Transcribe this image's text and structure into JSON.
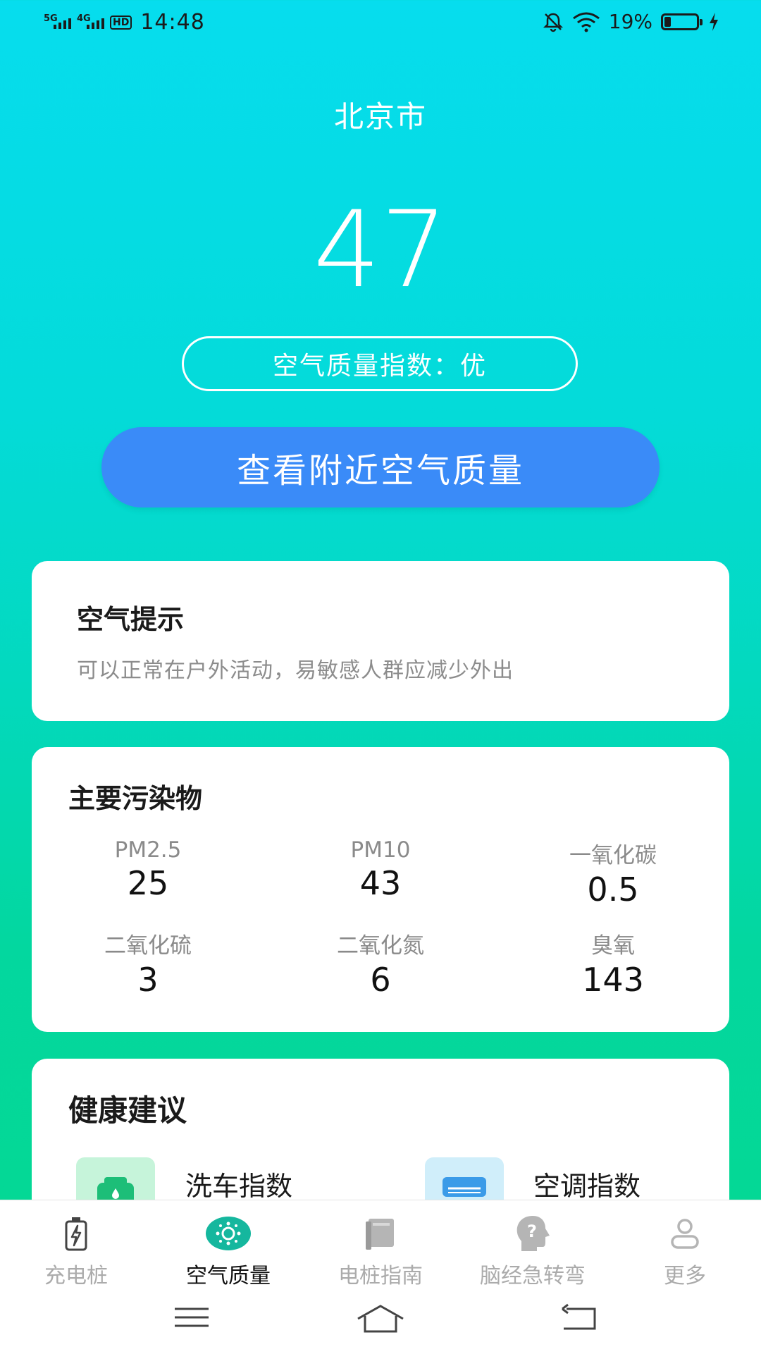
{
  "status_bar": {
    "signal1": "5G",
    "signal2": "4G",
    "hd": "HD",
    "time": "14:48",
    "battery": "19%"
  },
  "header": {
    "city": "北京市",
    "aqi_value": "47",
    "aqi_label": "空气质量指数：优",
    "nearby_button": "查看附近空气质量"
  },
  "tips": {
    "title": "空气提示",
    "text": "可以正常在户外活动，易敏感人群应减少外出"
  },
  "pollutants": {
    "title": "主要污染物",
    "items": [
      {
        "name": "PM2.5",
        "value": "25"
      },
      {
        "name": "PM10",
        "value": "43"
      },
      {
        "name": "一氧化碳",
        "value": "0.5"
      },
      {
        "name": "二氧化硫",
        "value": "3"
      },
      {
        "name": "二氧化氮",
        "value": "6"
      },
      {
        "name": "臭氧",
        "value": "143"
      }
    ]
  },
  "health": {
    "title": "健康建议",
    "items": [
      {
        "label": "洗车指数",
        "icon": "car-icon"
      },
      {
        "label": "空调指数",
        "icon": "air-conditioner-icon"
      }
    ]
  },
  "nav": {
    "tabs": [
      {
        "label": "充电桩",
        "icon": "battery-charging-icon"
      },
      {
        "label": "空气质量",
        "icon": "air-quality-icon"
      },
      {
        "label": "电桩指南",
        "icon": "book-icon"
      },
      {
        "label": "脑经急转弯",
        "icon": "question-head-icon"
      },
      {
        "label": "更多",
        "icon": "user-icon"
      }
    ],
    "active_index": 1
  },
  "colors": {
    "gradient_top": "#06DDEE",
    "gradient_bottom": "#05D88F",
    "button_blue": "#3A8BF8",
    "active_teal": "#15B79E"
  }
}
